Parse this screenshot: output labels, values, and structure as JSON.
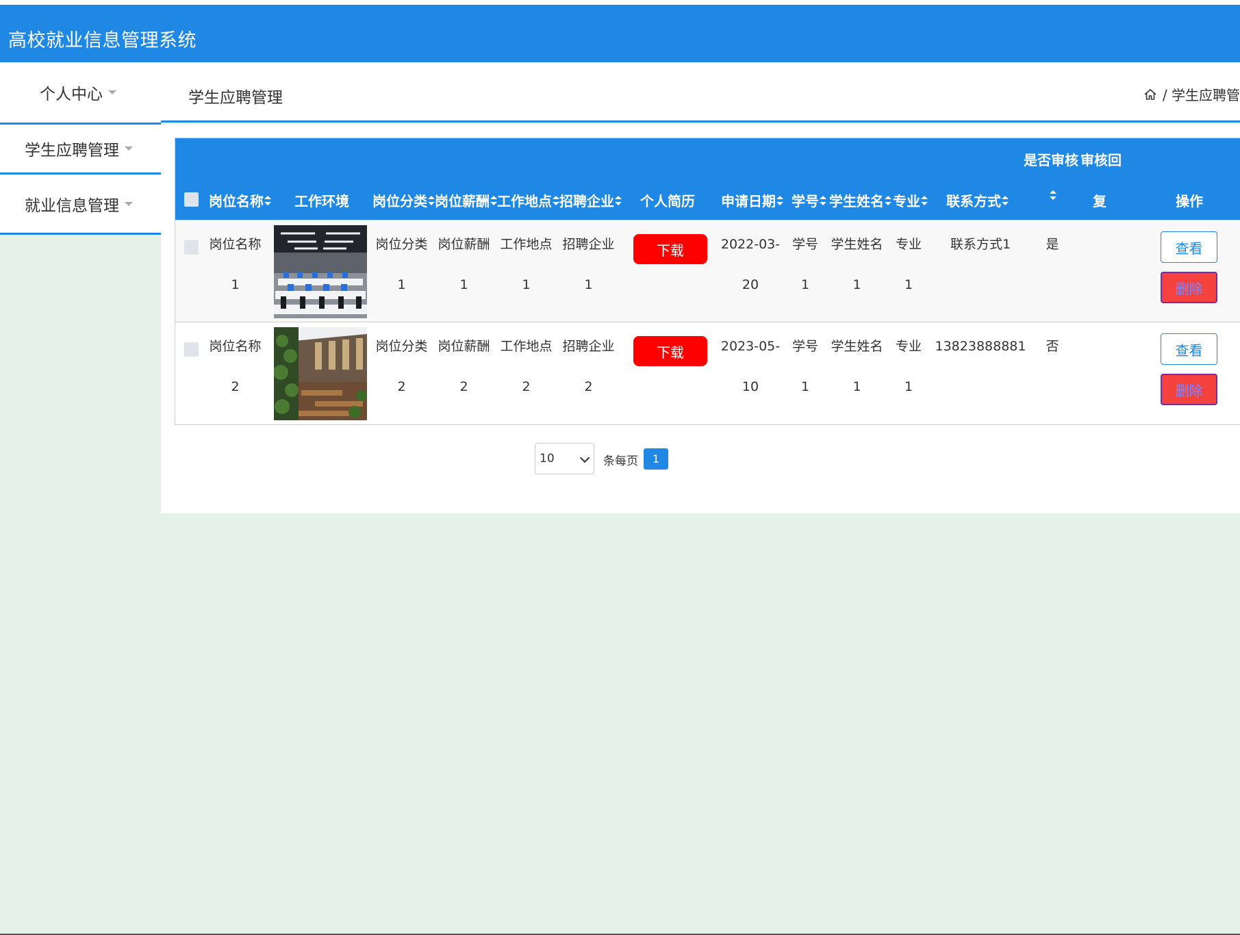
{
  "app": {
    "title": "高校就业信息管理系统"
  },
  "sidebar": {
    "items": [
      {
        "label": "个人中心"
      },
      {
        "label": "学生应聘管理"
      },
      {
        "label": "就业信息管理"
      }
    ]
  },
  "header": {
    "title": "学生应聘管理",
    "breadcrumb": "/ 学生应聘管"
  },
  "table": {
    "columns": {
      "name": "岗位名称",
      "env": "工作环境",
      "category": "岗位分类",
      "salary": "岗位薪酬",
      "location": "工作地点",
      "company": "招聘企业",
      "resume": "个人简历",
      "date": "申请日期",
      "student_no": "学号",
      "student_name": "学生姓名",
      "major": "专业",
      "contact": "联系方式",
      "review_l1": "是否审核",
      "reply_l1": "审核回",
      "reply_l2": "复",
      "action": "操作"
    },
    "rows": [
      {
        "name_l1": "岗位名称",
        "name_l2": "1",
        "category_l1": "岗位分类",
        "category_l2": "1",
        "salary_l1": "岗位薪酬",
        "salary_l2": "1",
        "location_l1": "工作地点",
        "location_l2": "1",
        "company_l1": "招聘企业",
        "company_l2": "1",
        "download": "下载",
        "date_l1": "2022-03-",
        "date_l2": "20",
        "sno_l1": "学号",
        "sno_l2": "1",
        "sname_l1": "学生姓名",
        "sname_l2": "1",
        "major_l1": "专业",
        "major_l2": "1",
        "contact": "联系方式1",
        "review": "是",
        "view": "查看",
        "delete": "删除"
      },
      {
        "name_l1": "岗位名称",
        "name_l2": "2",
        "category_l1": "岗位分类",
        "category_l2": "2",
        "salary_l1": "岗位薪酬",
        "salary_l2": "2",
        "location_l1": "工作地点",
        "location_l2": "2",
        "company_l1": "招聘企业",
        "company_l2": "2",
        "download": "下载",
        "date_l1": "2023-05-",
        "date_l2": "10",
        "sno_l1": "学号",
        "sno_l2": "1",
        "sname_l1": "学生姓名",
        "sname_l2": "1",
        "major_l1": "专业",
        "major_l2": "1",
        "contact": "13823888881",
        "review": "否",
        "view": "查看",
        "delete": "删除"
      }
    ]
  },
  "pagination": {
    "page_size": "10",
    "per_page_label": "条每页",
    "current_page": "1"
  },
  "colors": {
    "primary": "#1f88e5",
    "danger": "#ff0000",
    "background": "#e4f2ea"
  },
  "icons": {
    "home": "home-icon",
    "sort": "sort-icon",
    "caret": "caret-down-icon"
  }
}
